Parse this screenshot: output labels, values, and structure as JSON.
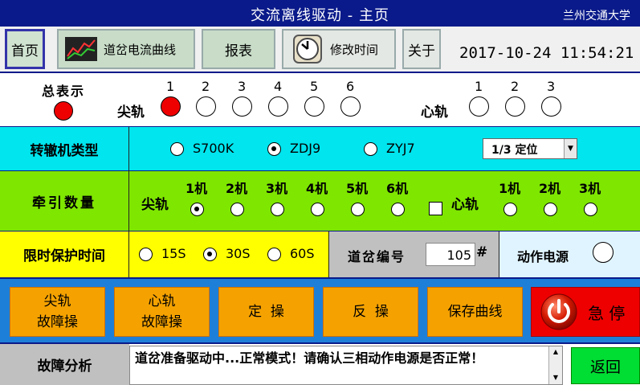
{
  "window": {
    "title": "交流离线驱动 - 主页",
    "org": "兰州交通大学"
  },
  "toolbar": {
    "home": "首页",
    "curve": "道岔电流曲线",
    "report": "报表",
    "time": "修改时间",
    "about": "关于",
    "datetime": "2017-10-24  11:54:21"
  },
  "status": {
    "total_label": "总表示",
    "tip_label": "尖轨",
    "heart_label": "心轨",
    "tip_numbers": [
      "1",
      "2",
      "3",
      "4",
      "5",
      "6"
    ],
    "heart_numbers": [
      "1",
      "2",
      "3"
    ],
    "total_on": true,
    "tip_on": [
      true,
      false,
      false,
      false,
      false,
      false
    ],
    "heart_on": [
      false,
      false,
      false
    ]
  },
  "machine": {
    "label": "转辙机类型",
    "options": [
      "S700K",
      "ZDJ9",
      "ZYJ7"
    ],
    "selected": "ZDJ9",
    "dropdown_value": "1/3 定位"
  },
  "traction": {
    "label": "牵引数量",
    "tip_label": "尖轨",
    "heart_label": "心轨",
    "tip_units": [
      "1机",
      "2机",
      "3机",
      "4机",
      "5机",
      "6机"
    ],
    "heart_units": [
      "1机",
      "2机",
      "3机"
    ],
    "tip_selected": 0,
    "heart_checked": false
  },
  "protect": {
    "label": "限时保护时间",
    "options": [
      "15S",
      "30S",
      "60S"
    ],
    "selected": "30S",
    "switch_no_label": "道岔编号",
    "switch_no_value": "105",
    "switch_no_unit": "#",
    "power_label": "动作电源"
  },
  "actions": {
    "tip_fault": [
      "尖轨",
      "故障操"
    ],
    "heart_fault": [
      "心轨",
      "故障操"
    ],
    "normal": "定  操",
    "reverse": "反  操",
    "save": "保存曲线",
    "stop": "急 停"
  },
  "fault": {
    "label": "故障分析",
    "message": "道岔准备驱动中...正常模式！请确认三相动作电源是否正常！",
    "back": "返回"
  },
  "colors": {
    "titlebar": "#0a1a8a",
    "cyan": "#00e5ee",
    "green": "#7fe600",
    "yellow": "#ffff00",
    "orange": "#f5a200",
    "red": "#ee0000"
  }
}
